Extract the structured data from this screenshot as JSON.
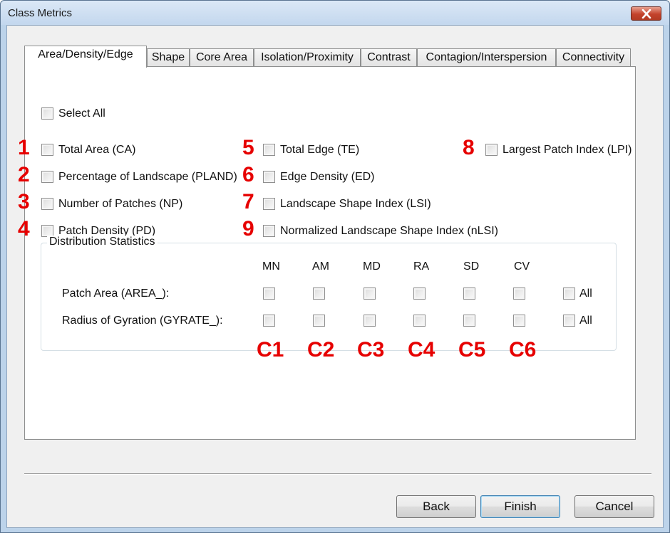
{
  "window": {
    "title": "Class Metrics"
  },
  "tabs": [
    {
      "label": "Area/Density/Edge",
      "active": true
    },
    {
      "label": "Shape"
    },
    {
      "label": "Core Area"
    },
    {
      "label": "Isolation/Proximity"
    },
    {
      "label": "Contrast"
    },
    {
      "label": "Contagion/Interspersion"
    },
    {
      "label": "Connectivity"
    }
  ],
  "select_all": "Select All",
  "metrics": [
    {
      "num": "1",
      "label": "Total Area (CA)"
    },
    {
      "num": "2",
      "label": "Percentage of Landscape (PLAND)"
    },
    {
      "num": "3",
      "label": "Number of Patches (NP)"
    },
    {
      "num": "4",
      "label": "Patch Density (PD)"
    },
    {
      "num": "5",
      "label": "Total Edge (TE)"
    },
    {
      "num": "6",
      "label": "Edge Density (ED)"
    },
    {
      "num": "7",
      "label": "Landscape Shape Index (LSI)"
    },
    {
      "num": "9",
      "label": "Normalized Landscape Shape Index (nLSI)"
    },
    {
      "num": "8",
      "label": "Largest Patch Index (LPI)"
    }
  ],
  "distribution": {
    "title": "Distribution Statistics",
    "columns": [
      "MN",
      "AM",
      "MD",
      "RA",
      "SD",
      "CV"
    ],
    "rows": [
      {
        "label": "Patch Area (AREA_):",
        "all": "All"
      },
      {
        "label": "Radius of Gyration (GYRATE_):",
        "all": "All"
      }
    ],
    "column_tags": [
      "C1",
      "C2",
      "C3",
      "C4",
      "C5",
      "C6"
    ]
  },
  "buttons": {
    "back": "Back",
    "finish": "Finish",
    "cancel": "Cancel"
  },
  "colors": {
    "annotation": "#e60000",
    "titlebar": "#c3d7ee",
    "close": "#c4432c"
  }
}
